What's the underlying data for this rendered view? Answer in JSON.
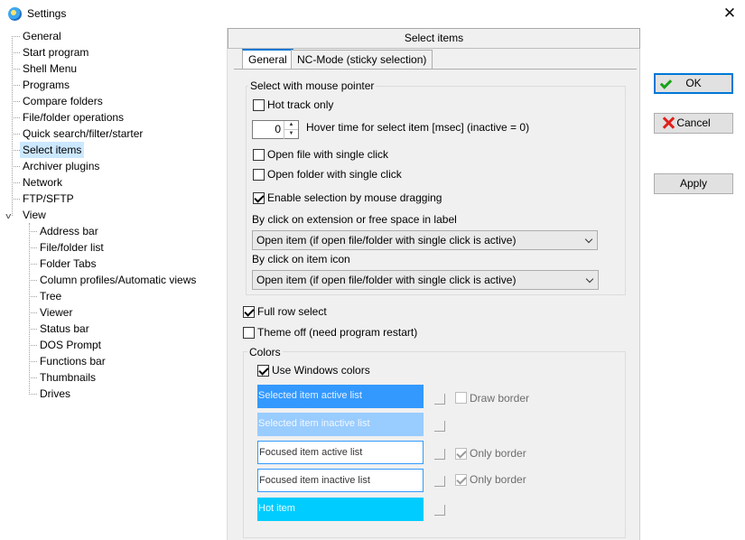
{
  "window": {
    "title": "Settings",
    "close_glyph": "✕"
  },
  "tree": {
    "items": [
      "General",
      "Start program",
      "Shell Menu",
      "Programs",
      "Compare folders",
      "File/folder operations",
      "Quick search/filter/starter",
      "Select items",
      "Archiver plugins",
      "Network",
      "FTP/SFTP",
      "View"
    ],
    "view_children": [
      "Address bar",
      "File/folder list",
      "Folder Tabs",
      "Column profiles/Automatic views",
      "Tree",
      "Viewer",
      "Status bar",
      "DOS Prompt",
      "Functions bar",
      "Thumbnails",
      "Drives"
    ],
    "selected": "Select items",
    "expander_glyph": "v"
  },
  "panel": {
    "header": "Select items",
    "tabs": [
      "General",
      "NC-Mode (sticky selection)"
    ],
    "active_tab": "General",
    "mouse_group": {
      "title": "Select with mouse pointer",
      "hot_track": {
        "label": "Hot track only",
        "checked": false
      },
      "hover_time": {
        "value": "0",
        "label": "Hover time for select item [msec] (inactive = 0)",
        "up": "▲",
        "down": "▼"
      },
      "open_file_single": {
        "label": "Open file with single click",
        "checked": false
      },
      "open_folder_single": {
        "label": "Open folder with single click",
        "checked": false
      },
      "enable_drag": {
        "label": "Enable selection by mouse dragging",
        "checked": true
      },
      "click_ext_label": "By click on extension or free space in label",
      "click_ext_value": "Open item (if open file/folder with single click is active)",
      "click_icon_label": "By click on item icon",
      "click_icon_value": "Open item (if open file/folder with single click is active)"
    },
    "full_row": {
      "label": "Full row select",
      "checked": true
    },
    "theme_off": {
      "label": "Theme off (need program restart)",
      "checked": false
    },
    "colors_group": {
      "title": "Colors",
      "use_windows": {
        "label": "Use Windows colors",
        "checked": true
      },
      "swatches": [
        {
          "label": "Selected item active list",
          "color": "#3399ff"
        },
        {
          "label": "Selected item inactive list",
          "color": "#99ccff"
        },
        {
          "label": "Focused item active list",
          "color": "#ffffff"
        },
        {
          "label": "Focused item inactive list",
          "color": "#ffffff"
        },
        {
          "label": "Hot item",
          "color": "#00ccff"
        }
      ],
      "draw_border": {
        "label": "Draw border",
        "checked": false
      },
      "only_border_1": {
        "label": "Only border",
        "checked": true
      },
      "only_border_2": {
        "label": "Only border",
        "checked": true
      }
    }
  },
  "buttons": {
    "ok": "OK",
    "cancel": "Cancel",
    "apply": "Apply"
  },
  "colors": {
    "accent": "#0078d7",
    "selection": "#cce8ff"
  }
}
